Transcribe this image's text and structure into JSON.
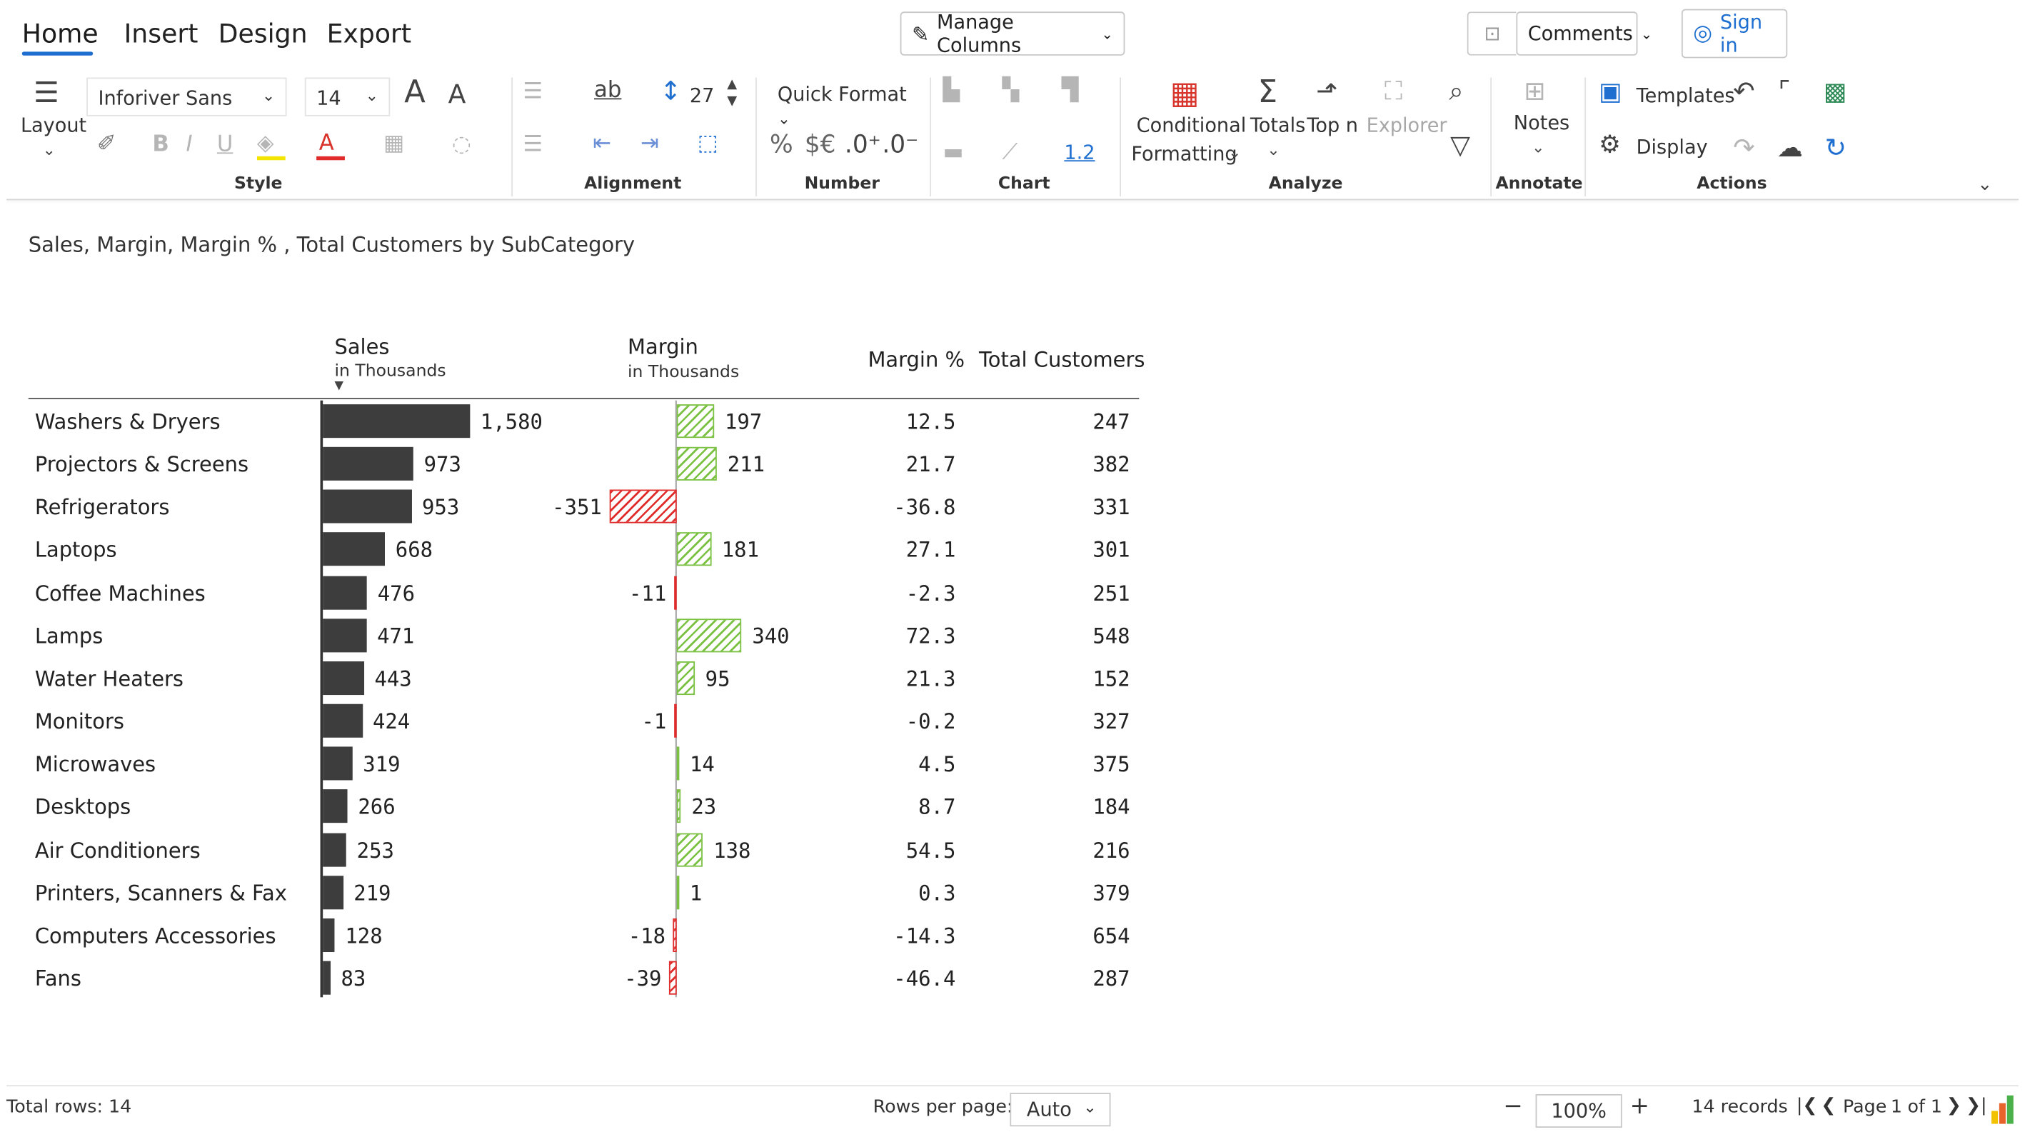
{
  "tabs": [
    "Home",
    "Insert",
    "Design",
    "Export"
  ],
  "header": {
    "manage_columns": "Manage Columns",
    "comments": "Comments",
    "sign_in": "Sign in"
  },
  "ribbon": {
    "layout_label": "Layout",
    "font_family": "Inforiver Sans",
    "font_size": "14",
    "row_height": "27",
    "quick_format": "Quick Format",
    "decimal_value": "1.2",
    "conditional": "Conditional",
    "formatting": "Formatting",
    "totals": "Totals",
    "top_n": "Top n",
    "explorer": "Explorer",
    "notes": "Notes",
    "templates": "Templates",
    "display": "Display",
    "groups": {
      "style": "Style",
      "alignment": "Alignment",
      "number": "Number",
      "chart": "Chart",
      "analyze": "Analyze",
      "annotate": "Annotate",
      "actions": "Actions"
    }
  },
  "report": {
    "title": "Sales, Margin, Margin % , Total Customers by SubCategory",
    "columns": {
      "sales": "Sales",
      "sales_unit": "in Thousands",
      "margin": "Margin",
      "margin_unit": "in Thousands",
      "margin_pct": "Margin %",
      "customers": "Total Customers"
    },
    "rows": [
      {
        "name": "Washers & Dryers",
        "sales": 1580,
        "sales_label": "1,580",
        "margin": 197,
        "margin_label": "197",
        "margin_pct": "12.5",
        "customers": "247"
      },
      {
        "name": "Projectors & Screens",
        "sales": 973,
        "sales_label": "973",
        "margin": 211,
        "margin_label": "211",
        "margin_pct": "21.7",
        "customers": "382"
      },
      {
        "name": "Refrigerators",
        "sales": 953,
        "sales_label": "953",
        "margin": -351,
        "margin_label": "-351",
        "margin_pct": "-36.8",
        "customers": "331"
      },
      {
        "name": "Laptops",
        "sales": 668,
        "sales_label": "668",
        "margin": 181,
        "margin_label": "181",
        "margin_pct": "27.1",
        "customers": "301"
      },
      {
        "name": "Coffee Machines",
        "sales": 476,
        "sales_label": "476",
        "margin": -11,
        "margin_label": "-11",
        "margin_pct": "-2.3",
        "customers": "251"
      },
      {
        "name": "Lamps",
        "sales": 471,
        "sales_label": "471",
        "margin": 340,
        "margin_label": "340",
        "margin_pct": "72.3",
        "customers": "548"
      },
      {
        "name": "Water Heaters",
        "sales": 443,
        "sales_label": "443",
        "margin": 95,
        "margin_label": "95",
        "margin_pct": "21.3",
        "customers": "152"
      },
      {
        "name": "Monitors",
        "sales": 424,
        "sales_label": "424",
        "margin": -1,
        "margin_label": "-1",
        "margin_pct": "-0.2",
        "customers": "327"
      },
      {
        "name": "Microwaves",
        "sales": 319,
        "sales_label": "319",
        "margin": 14,
        "margin_label": "14",
        "margin_pct": "4.5",
        "customers": "375"
      },
      {
        "name": "Desktops",
        "sales": 266,
        "sales_label": "266",
        "margin": 23,
        "margin_label": "23",
        "margin_pct": "8.7",
        "customers": "184"
      },
      {
        "name": "Air Conditioners",
        "sales": 253,
        "sales_label": "253",
        "margin": 138,
        "margin_label": "138",
        "margin_pct": "54.5",
        "customers": "216"
      },
      {
        "name": "Printers, Scanners & Fax",
        "sales": 219,
        "sales_label": "219",
        "margin": 1,
        "margin_label": "1",
        "margin_pct": "0.3",
        "customers": "379"
      },
      {
        "name": "Computers Accessories",
        "sales": 128,
        "sales_label": "128",
        "margin": -18,
        "margin_label": "-18",
        "margin_pct": "-14.3",
        "customers": "654"
      },
      {
        "name": "Fans",
        "sales": 83,
        "sales_label": "83",
        "margin": -39,
        "margin_label": "-39",
        "margin_pct": "-46.4",
        "customers": "287"
      }
    ]
  },
  "footer": {
    "total_rows": "Total rows: 14",
    "rows_per_page_label": "Rows per page:",
    "rows_per_page_value": "Auto",
    "zoom": "100%",
    "records": "14 records",
    "page_label": "Page",
    "page_current": "1",
    "page_of": "of 1"
  },
  "colors": {
    "accent": "#1f6fd1",
    "sales_bar": "#3d3d3d",
    "positive": "#7ac142",
    "negative": "#e02b2b"
  }
}
